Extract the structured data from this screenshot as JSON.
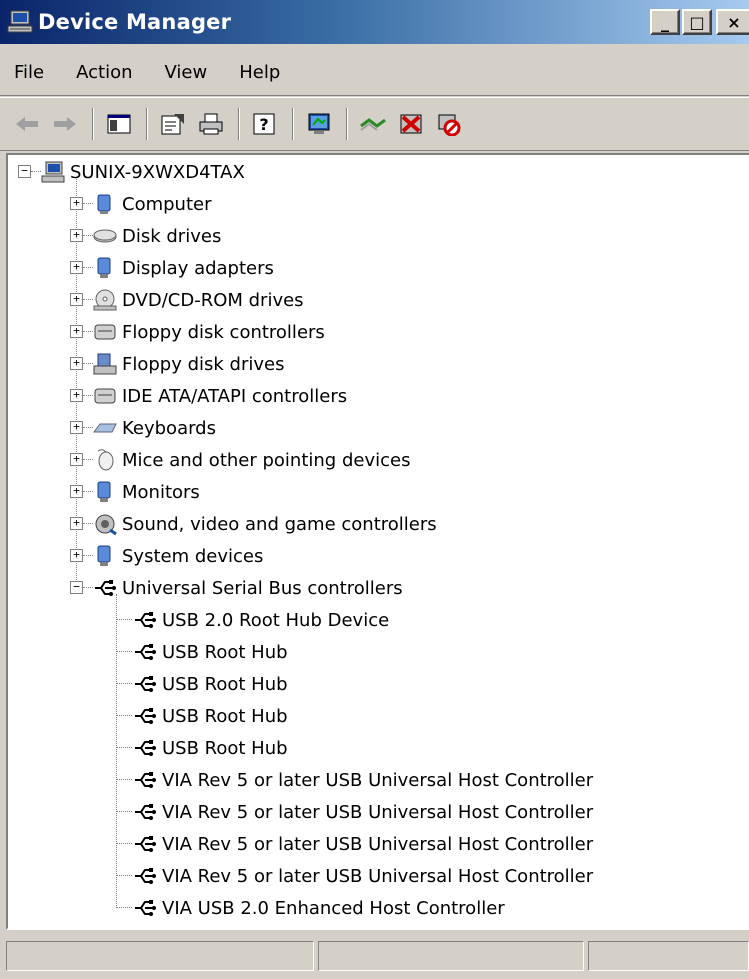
{
  "window": {
    "title": "Device Manager",
    "buttons": {
      "minimize": "_",
      "maximize": "□",
      "close": "×"
    }
  },
  "menu": [
    "File",
    "Action",
    "View",
    "Help"
  ],
  "toolbar": {
    "icons": [
      "back-arrow-icon",
      "forward-arrow-icon",
      "show-hide-console-tree-icon",
      "properties-icon",
      "print-icon",
      "help-icon",
      "scan-hardware-icon",
      "update-driver-icon",
      "uninstall-icon",
      "disable-icon"
    ]
  },
  "tree": {
    "root": {
      "label": "SUNIX-9XWXD4TAX",
      "icon": "computer-icon",
      "expanded": true
    },
    "categories": [
      {
        "label": "Computer",
        "icon": "computer-category-icon",
        "expanded": false
      },
      {
        "label": "Disk drives",
        "icon": "disk-drive-icon",
        "expanded": false
      },
      {
        "label": "Display adapters",
        "icon": "display-adapter-icon",
        "expanded": false
      },
      {
        "label": "DVD/CD-ROM drives",
        "icon": "dvd-drive-icon",
        "expanded": false
      },
      {
        "label": "Floppy disk controllers",
        "icon": "floppy-controller-icon",
        "expanded": false
      },
      {
        "label": "Floppy disk drives",
        "icon": "floppy-drive-icon",
        "expanded": false
      },
      {
        "label": "IDE ATA/ATAPI controllers",
        "icon": "ide-controller-icon",
        "expanded": false
      },
      {
        "label": "Keyboards",
        "icon": "keyboard-icon",
        "expanded": false
      },
      {
        "label": "Mice and other pointing devices",
        "icon": "mouse-icon",
        "expanded": false
      },
      {
        "label": "Monitors",
        "icon": "monitor-icon",
        "expanded": false
      },
      {
        "label": "Sound, video and game controllers",
        "icon": "sound-icon",
        "expanded": false
      },
      {
        "label": "System devices",
        "icon": "system-devices-icon",
        "expanded": false
      },
      {
        "label": "Universal Serial Bus controllers",
        "icon": "usb-icon",
        "expanded": true
      }
    ],
    "usb_devices": [
      "USB 2.0 Root Hub Device",
      "USB Root Hub",
      "USB Root Hub",
      "USB Root Hub",
      "USB Root Hub",
      "VIA Rev 5 or later USB Universal Host Controller",
      "VIA Rev 5 or later USB Universal Host Controller",
      "VIA Rev 5 or later USB Universal Host Controller",
      "VIA Rev 5 or later USB Universal Host Controller",
      "VIA USB 2.0 Enhanced Host Controller"
    ]
  },
  "statusbar": {
    "panes": [
      "",
      "",
      ""
    ]
  },
  "colors": {
    "titlebar_start": "#0a246a",
    "titlebar_end": "#a6caf0",
    "face": "#d4d0c8"
  }
}
